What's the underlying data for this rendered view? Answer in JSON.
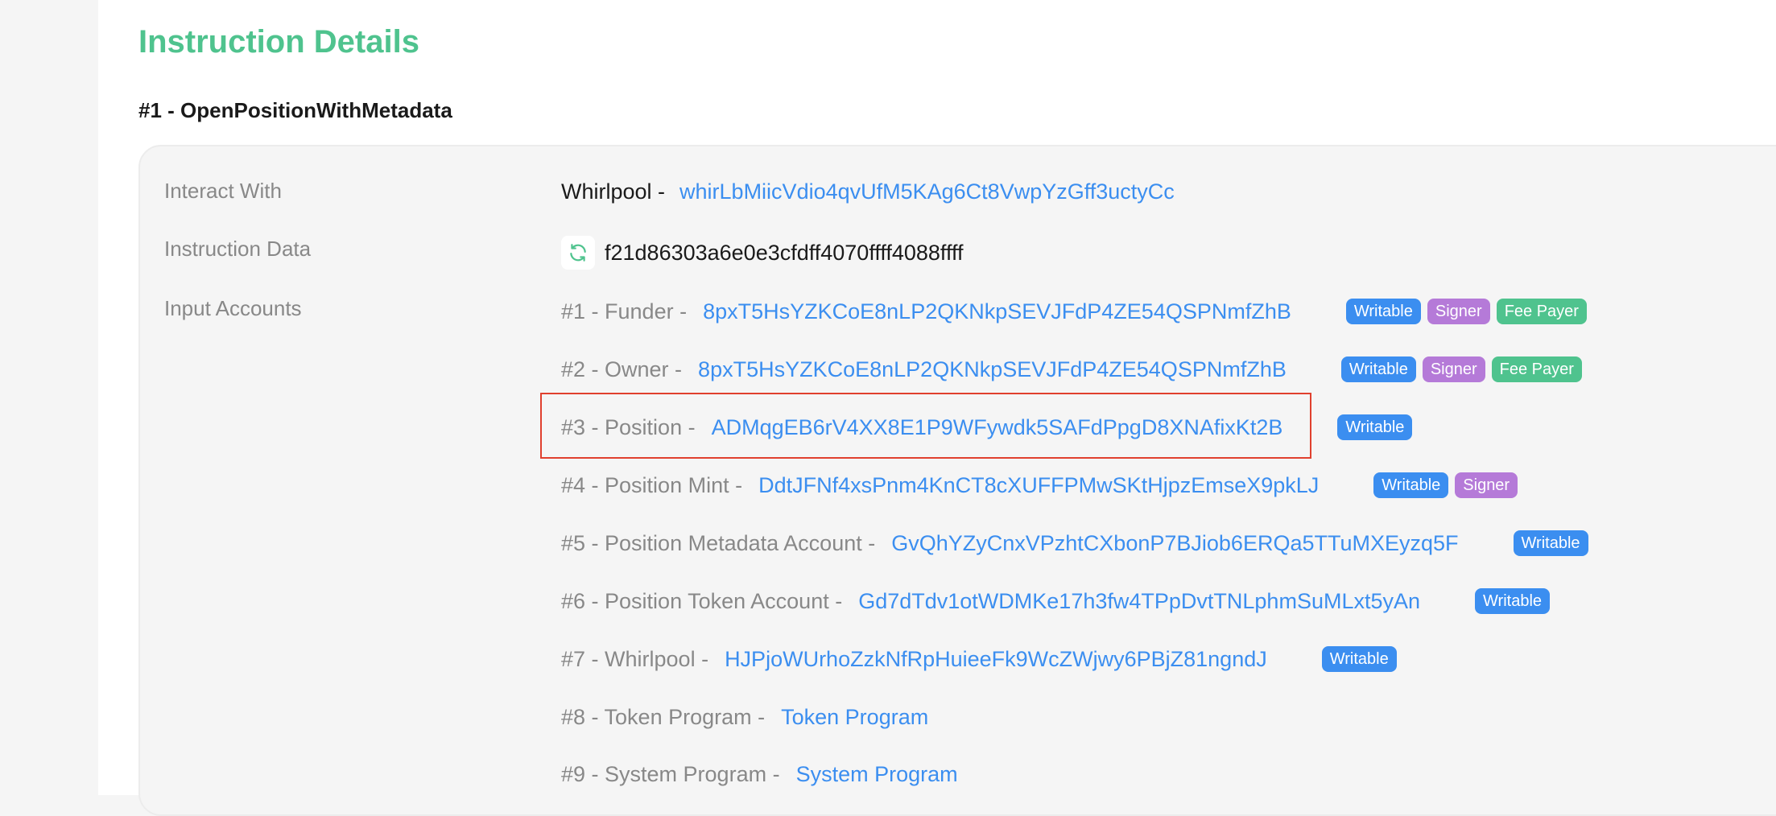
{
  "page": {
    "title": "Instruction Details"
  },
  "instruction": {
    "title": "#1 - OpenPositionWithMetadata",
    "interact_with": {
      "label": "Interact With",
      "prefix": "Whirlpool -",
      "address": "whirLbMiicVdio4qvUfM5KAg6Ct8VwpYzGff3uctyCc"
    },
    "instruction_data": {
      "label": "Instruction Data",
      "icon": "refresh-icon",
      "value": "f21d86303a6e0e3cfdff4070ffff4088ffff"
    },
    "input_accounts": {
      "label": "Input Accounts",
      "accounts": [
        {
          "prefix": "#1 - Funder -",
          "address": "8pxT5HsYZKCoE8nLP2QKNkpSEVJFdP4ZE54QSPNmfZhB",
          "badges": [
            "Writable",
            "Signer",
            "Fee Payer"
          ]
        },
        {
          "prefix": "#2 - Owner -",
          "address": "8pxT5HsYZKCoE8nLP2QKNkpSEVJFdP4ZE54QSPNmfZhB",
          "badges": [
            "Writable",
            "Signer",
            "Fee Payer"
          ]
        },
        {
          "prefix": "#3 - Position -",
          "address": "ADMqgEB6rV4XX8E1P9WFywdk5SAFdPpgD8XNAfixKt2B",
          "badges": [
            "Writable"
          ]
        },
        {
          "prefix": "#4 - Position Mint -",
          "address": "DdtJFNf4xsPnm4KnCT8cXUFFPMwSKtHjpzEmseX9pkLJ",
          "badges": [
            "Writable",
            "Signer"
          ]
        },
        {
          "prefix": "#5 - Position Metadata Account -",
          "address": "GvQhYZyCnxVPzhtCXbonP7BJiob6ERQa5TTuMXEyzq5F",
          "badges": [
            "Writable"
          ]
        },
        {
          "prefix": "#6 - Position Token Account -",
          "address": "Gd7dTdv1otWDMKe17h3fw4TPpDvtTNLphmSuMLxt5yAn",
          "badges": [
            "Writable"
          ]
        },
        {
          "prefix": "#7 - Whirlpool -",
          "address": "HJPjoWUrhoZzkNfRpHuieeFk9WcZWjwy6PBjZ81ngndJ",
          "badges": [
            "Writable"
          ]
        },
        {
          "prefix": "#8 - Token Program -",
          "address": "Token Program",
          "badges": []
        },
        {
          "prefix": "#9 - System Program -",
          "address": "System Program",
          "badges": []
        }
      ]
    }
  },
  "colors": {
    "accent": "#4fc38e",
    "link": "#3b8ef0",
    "writable": "#3b8ef0",
    "signer": "#b57ad8",
    "fee_payer": "#4fc38e",
    "highlight": "#e0402e"
  }
}
